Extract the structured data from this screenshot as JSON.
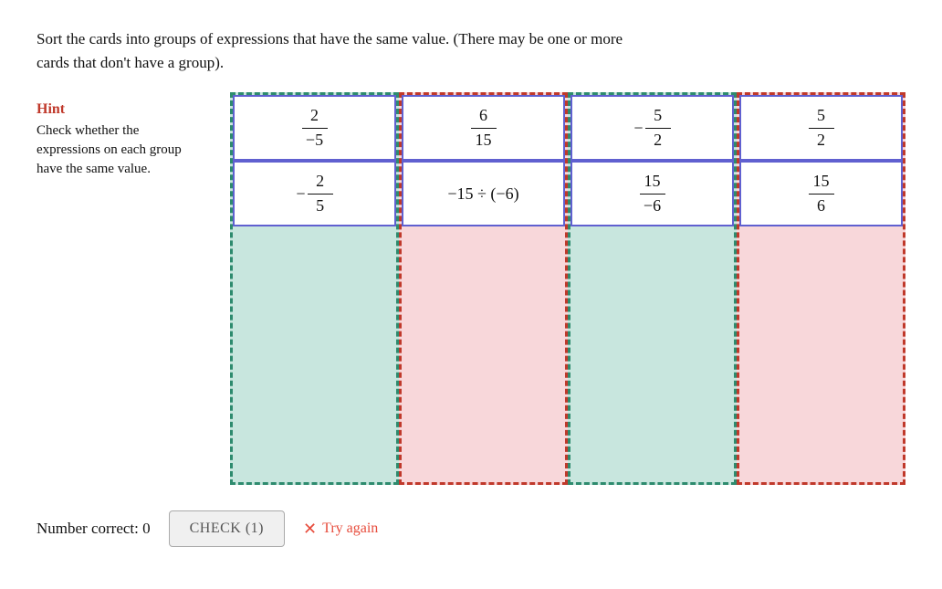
{
  "instructions": {
    "line1": "Sort the cards into groups of expressions that have the same value. (There may be one or more",
    "line2": "cards that don't have a group)."
  },
  "hint": {
    "title": "Hint",
    "text": "Check whether the expressions on each group have the same value."
  },
  "groups": [
    {
      "id": "group1",
      "style": "teal",
      "cards": [
        {
          "type": "fraction",
          "numerator": "2",
          "denominator": "−5",
          "neg_prefix": ""
        },
        {
          "type": "neg_fraction",
          "numerator": "2",
          "denominator": "5",
          "neg_prefix": "−"
        }
      ]
    },
    {
      "id": "group2",
      "style": "red",
      "cards": [
        {
          "type": "fraction",
          "numerator": "6",
          "denominator": "15",
          "neg_prefix": ""
        },
        {
          "type": "expression",
          "text": "−15 ÷ (−6)"
        }
      ]
    },
    {
      "id": "group3",
      "style": "teal",
      "cards": [
        {
          "type": "neg_fraction",
          "numerator": "5",
          "denominator": "2",
          "neg_prefix": "−"
        },
        {
          "type": "fraction",
          "numerator": "15",
          "denominator": "−6",
          "neg_prefix": ""
        }
      ]
    },
    {
      "id": "group4",
      "style": "red",
      "cards": [
        {
          "type": "fraction",
          "numerator": "5",
          "denominator": "2",
          "neg_prefix": ""
        },
        {
          "type": "fraction",
          "numerator": "15",
          "denominator": "6",
          "neg_prefix": ""
        }
      ]
    }
  ],
  "bottom": {
    "number_correct_label": "Number correct: 0",
    "check_button": "CHECK (1)",
    "try_again": "Try again"
  }
}
